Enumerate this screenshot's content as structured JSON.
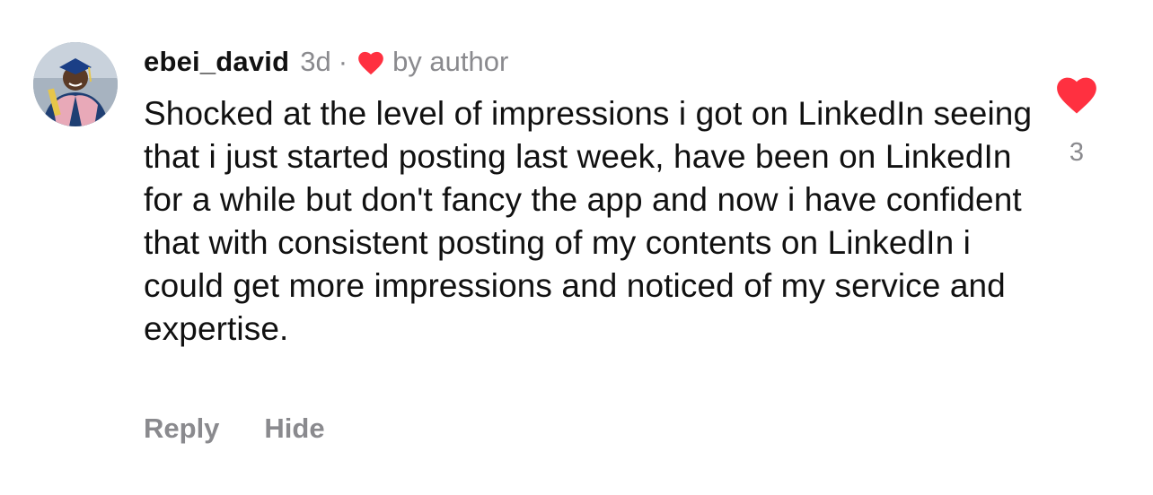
{
  "comment": {
    "username": "ebei_david",
    "time": "3d",
    "separator": "·",
    "liked_by_author_label": "by author",
    "text": "Shocked at the level of impressions i got on LinkedIn seeing that i just started posting last week, have been on LinkedIn for a while but don't fancy the app and now i have confident that with consistent posting of my contents on LinkedIn i could get more impressions and noticed of my service and expertise.",
    "like_count": "3",
    "actions": {
      "reply_label": "Reply",
      "hide_label": "Hide"
    }
  },
  "icons": {
    "author_like": "heart-icon",
    "like_button": "heart-icon"
  },
  "colors": {
    "heart": "#ff3040",
    "secondary_text": "#8a8a8e",
    "primary_text": "#111111"
  }
}
